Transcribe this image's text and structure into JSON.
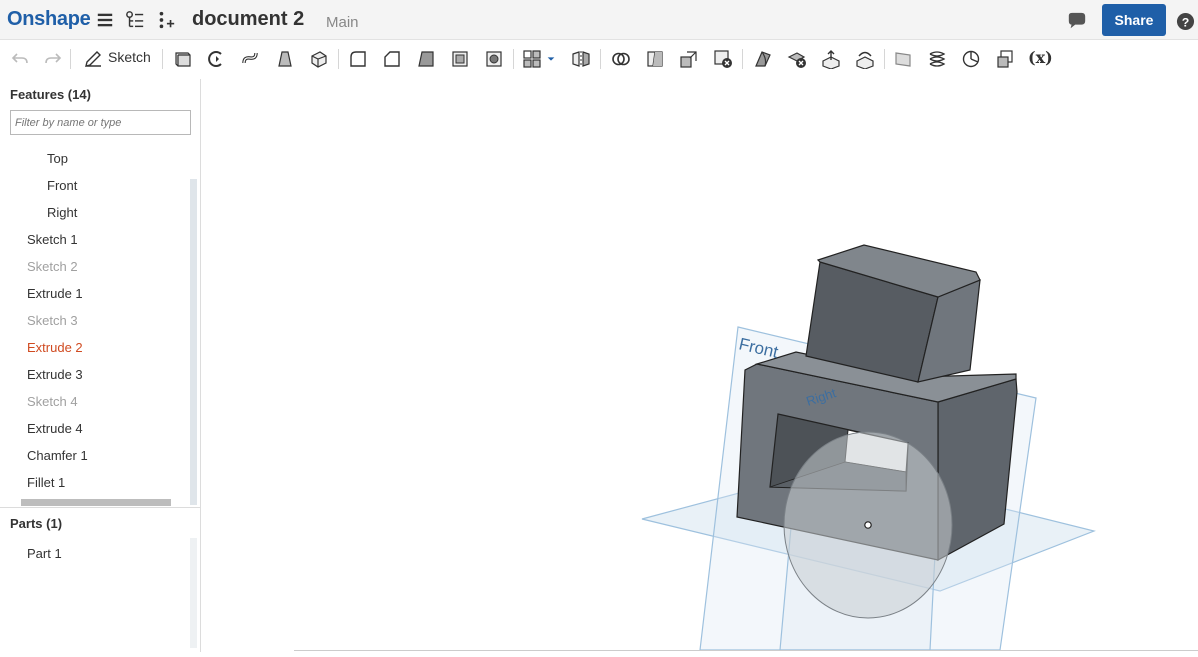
{
  "app": {
    "logo": "Onshape"
  },
  "document": {
    "title": "document 2",
    "branch": "Main"
  },
  "header": {
    "share_label": "Share"
  },
  "toolbar": {
    "sketch_label": "Sketch",
    "variable_label": "(x)"
  },
  "features": {
    "heading": "Features (14)",
    "filter_placeholder": "Filter by name or type",
    "items": [
      {
        "label": "Top",
        "state": "normal"
      },
      {
        "label": "Front",
        "state": "normal"
      },
      {
        "label": "Right",
        "state": "normal"
      },
      {
        "label": "Sketch 1",
        "state": "normal"
      },
      {
        "label": "Sketch 2",
        "state": "suppressed"
      },
      {
        "label": "Extrude 1",
        "state": "normal"
      },
      {
        "label": "Sketch 3",
        "state": "suppressed"
      },
      {
        "label": "Extrude 2",
        "state": "error"
      },
      {
        "label": "Extrude 3",
        "state": "normal"
      },
      {
        "label": "Sketch 4",
        "state": "suppressed"
      },
      {
        "label": "Extrude 4",
        "state": "normal"
      },
      {
        "label": "Chamfer 1",
        "state": "normal"
      },
      {
        "label": "Fillet 1",
        "state": "normal"
      }
    ]
  },
  "parts": {
    "heading": "Parts (1)",
    "items": [
      {
        "label": "Part 1"
      }
    ]
  },
  "viewport": {
    "plane_front_label": "Front",
    "plane_right_label": "Right"
  },
  "colors": {
    "brand": "#1f5fa8",
    "error": "#d04a20",
    "plane": "#9ec1de",
    "part": "#5f656c"
  }
}
